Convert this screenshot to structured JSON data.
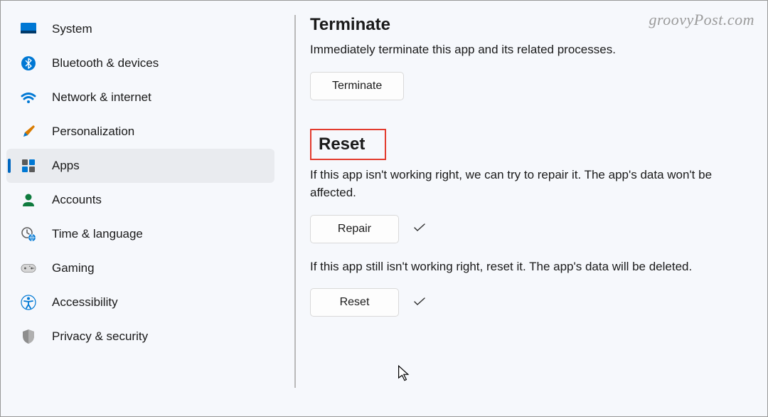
{
  "watermark": "groovyPost.com",
  "sidebar": {
    "items": [
      {
        "label": "System"
      },
      {
        "label": "Bluetooth & devices"
      },
      {
        "label": "Network & internet"
      },
      {
        "label": "Personalization"
      },
      {
        "label": "Apps"
      },
      {
        "label": "Accounts"
      },
      {
        "label": "Time & language"
      },
      {
        "label": "Gaming"
      },
      {
        "label": "Accessibility"
      },
      {
        "label": "Privacy & security"
      }
    ]
  },
  "main": {
    "terminate": {
      "heading": "Terminate",
      "desc": "Immediately terminate this app and its related processes.",
      "button": "Terminate"
    },
    "reset": {
      "heading": "Reset",
      "repair_desc": "If this app isn't working right, we can try to repair it. The app's data won't be affected.",
      "repair_button": "Repair",
      "reset_desc": "If this app still isn't working right, reset it. The app's data will be deleted.",
      "reset_button": "Reset"
    }
  }
}
